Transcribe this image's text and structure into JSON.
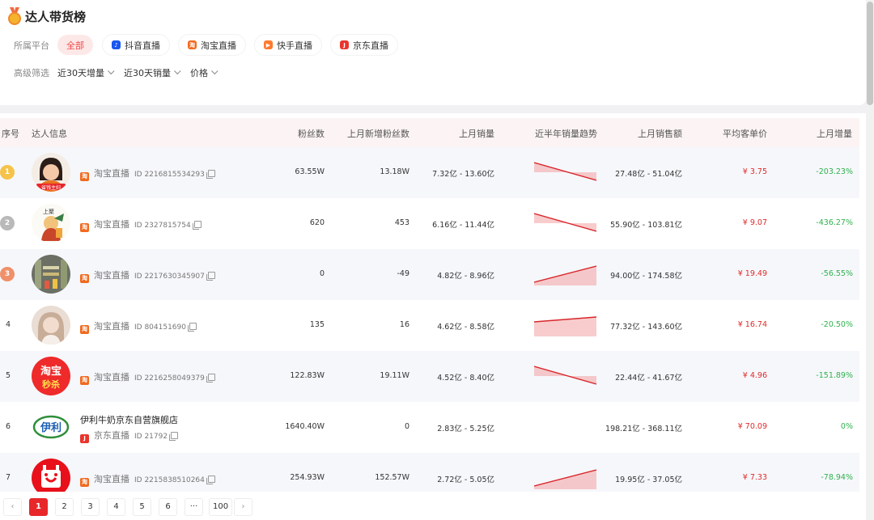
{
  "page": {
    "title": "达人带货榜"
  },
  "filters": {
    "platform_label": "所属平台",
    "platforms": [
      {
        "label": "全部",
        "active": true,
        "icon": "",
        "color": ""
      },
      {
        "label": "抖音直播",
        "active": false,
        "icon": "douyin-icon",
        "color": "#1a56f0"
      },
      {
        "label": "淘宝直播",
        "active": false,
        "icon": "taobao-icon",
        "color": "#f06a1f"
      },
      {
        "label": "快手直播",
        "active": false,
        "icon": "kuaishou-icon",
        "color": "#ff7a2d"
      },
      {
        "label": "京东直播",
        "active": false,
        "icon": "jd-icon",
        "color": "#e8352d"
      }
    ],
    "advanced_label": "高级筛选",
    "dropdowns": [
      "近30天增量",
      "近30天销量",
      "价格"
    ]
  },
  "table": {
    "headers": {
      "rank": "序号",
      "info": "达人信息",
      "fans": "粉丝数",
      "new_fans": "上月新增粉丝数",
      "sales": "上月销量",
      "trend": "近半年销量趋势",
      "revenue": "上月销售额",
      "avg_price": "平均客单价",
      "growth": "上月增量"
    },
    "rows": [
      {
        "rank": "1",
        "name": "",
        "source": "淘宝直播",
        "id": "ID 2216815534293",
        "fans": "63.55W",
        "new_fans": "13.18W",
        "sales": "7.32亿 - 13.60亿",
        "trend": "down",
        "revenue": "27.48亿 - 51.04亿",
        "avg_price": "¥ 3.75",
        "growth": "-203.23%",
        "avatar": "avatar-woman-icon"
      },
      {
        "rank": "2",
        "name": "",
        "source": "淘宝直播",
        "id": "ID 2327815754",
        "fans": "620",
        "new_fans": "453",
        "sales": "6.16亿 - 11.44亿",
        "trend": "down",
        "revenue": "55.90亿 - 103.81亿",
        "avg_price": "¥ 9.07",
        "growth": "-436.27%",
        "avatar": "avatar-cartoon-icon"
      },
      {
        "rank": "3",
        "name": "",
        "source": "淘宝直播",
        "id": "ID 2217630345907",
        "fans": "0",
        "new_fans": "-49",
        "sales": "4.82亿 - 8.96亿",
        "trend": "up",
        "revenue": "94.00亿 - 174.58亿",
        "avg_price": "¥ 19.49",
        "growth": "-56.55%",
        "avatar": "avatar-store-icon"
      },
      {
        "rank": "4",
        "name": "",
        "source": "淘宝直播",
        "id": "ID 804151690",
        "fans": "135",
        "new_fans": "16",
        "sales": "4.62亿 - 8.58亿",
        "trend": "flat-up",
        "revenue": "77.32亿 - 143.60亿",
        "avg_price": "¥ 16.74",
        "growth": "-20.50%",
        "avatar": "avatar-portrait-icon"
      },
      {
        "rank": "5",
        "name": "",
        "source": "淘宝直播",
        "id": "ID 2216258049379",
        "fans": "122.83W",
        "new_fans": "19.11W",
        "sales": "4.52亿 - 8.40亿",
        "trend": "down",
        "revenue": "22.44亿 - 41.67亿",
        "avg_price": "¥ 4.96",
        "growth": "-151.89%",
        "avatar": "avatar-taobao-logo-icon"
      },
      {
        "rank": "6",
        "name": "伊利牛奶京东自营旗舰店",
        "source": "京东直播",
        "id": "ID 21792",
        "fans": "1640.40W",
        "new_fans": "0",
        "sales": "2.83亿 - 5.25亿",
        "trend": "",
        "revenue": "198.21亿 - 368.11亿",
        "avg_price": "¥ 70.09",
        "growth": "0%",
        "avatar": "avatar-yili-logo-icon"
      },
      {
        "rank": "7",
        "name": "",
        "source": "淘宝直播",
        "id": "ID 2215838510264",
        "fans": "254.93W",
        "new_fans": "152.57W",
        "sales": "2.72亿 - 5.05亿",
        "trend": "up",
        "revenue": "19.95亿 - 37.05亿",
        "avg_price": "¥ 7.33",
        "growth": "-78.94%",
        "avatar": "avatar-tmall-logo-icon"
      }
    ]
  },
  "logos": {
    "taobao_line1": "淘宝",
    "taobao_line2": "秒杀",
    "yili": "伊利",
    "avatar1_caption": "省钱主妇",
    "avatar2_caption": "上聚"
  },
  "pagination": {
    "pages": [
      "1",
      "2",
      "3",
      "4",
      "5",
      "6",
      "···",
      "100"
    ],
    "current": "1"
  },
  "colors": {
    "accent": "#e8272b",
    "positive": "#2fb24d",
    "money": "#e02b2b",
    "rank_gold": "#f5c34a",
    "rank_silver": "#b9b9b9",
    "rank_bronze": "#f0906a"
  }
}
